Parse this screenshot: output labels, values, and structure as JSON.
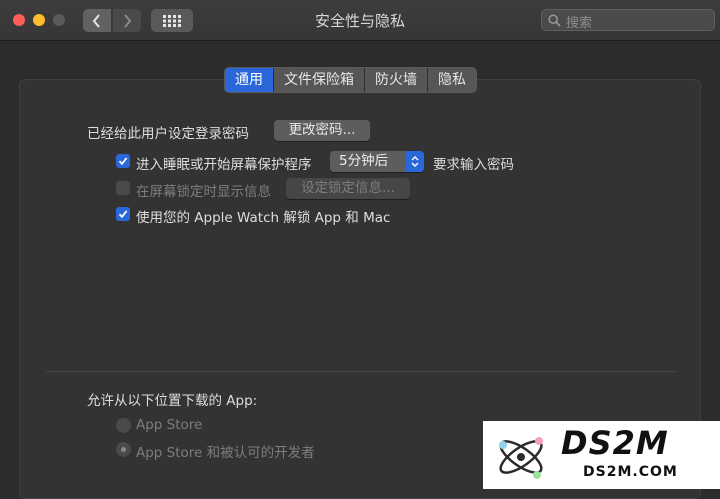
{
  "window": {
    "title": "安全性与隐私"
  },
  "search": {
    "placeholder": "搜索"
  },
  "tabs": [
    {
      "label": "通用",
      "active": true
    },
    {
      "label": "文件保险箱",
      "active": false
    },
    {
      "label": "防火墙",
      "active": false
    },
    {
      "label": "隐私",
      "active": false
    }
  ],
  "general": {
    "password_set_label": "已经给此用户设定登录密码",
    "change_password_button": "更改密码...",
    "require_password": {
      "checked": true,
      "label": "进入睡眠或开始屏幕保护程序",
      "delay_value": "5分钟后",
      "suffix": "要求输入密码"
    },
    "lock_message": {
      "checked": false,
      "enabled": false,
      "label": "在屏幕锁定时显示信息",
      "button": "设定锁定信息..."
    },
    "apple_watch": {
      "checked": true,
      "label": "使用您的 Apple Watch 解锁 App 和 Mac"
    }
  },
  "downloads": {
    "heading": "允许从以下位置下载的 App:",
    "options": [
      {
        "label": "App Store",
        "selected": false,
        "enabled": false
      },
      {
        "label": "App Store 和被认可的开发者",
        "selected": true,
        "enabled": false
      }
    ]
  },
  "watermark": {
    "brand": "DS2M",
    "url": "DS2M.COM"
  },
  "colors": {
    "accent": "#2a68d9",
    "background": "#2c2c2c"
  }
}
